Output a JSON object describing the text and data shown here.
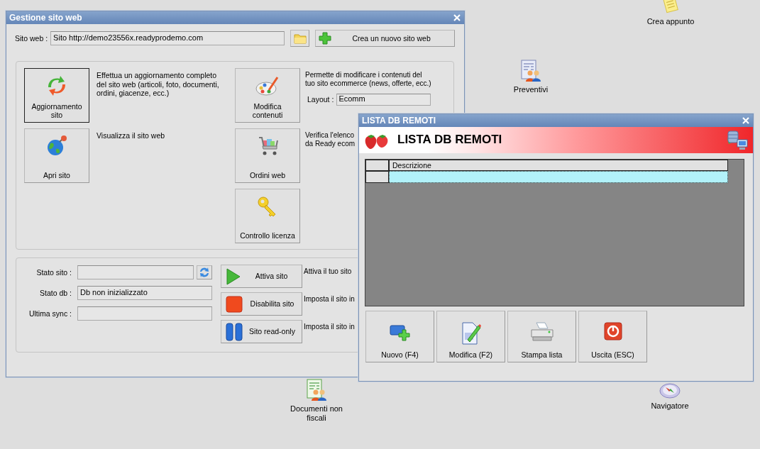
{
  "desktop_icons": [
    {
      "label": "Crea appunto"
    },
    {
      "label": "Preventivi"
    },
    {
      "label": "Documenti non fiscali"
    },
    {
      "label": "Navigatore"
    }
  ],
  "main_window": {
    "title": "Gestione sito web",
    "site": {
      "label": "Sito web :",
      "value": "Sito http://demo23556x.readyprodemo.com"
    },
    "create_button": "Crea un nuovo sito web",
    "tiles": [
      {
        "label": "Aggiornamento\nsito",
        "focused": true,
        "description": "Effettua un aggiornamento completo del sito web (articoli, foto, documenti, ordini, giacenze, ecc.)"
      },
      {
        "label": "Apri sito",
        "focused": false,
        "description": "Visualizza il sito web"
      },
      {
        "label": "Modifica\ncontenuti",
        "focused": false,
        "description": "Permette di modificare i contenuti del tuo sito ecommerce (news, offerte, ecc.)",
        "layout": {
          "label": "Layout :",
          "value": "Ecomm"
        }
      },
      {
        "label": "Ordini web",
        "focused": false,
        "description": "Verifica l'elenco\nda Ready ecom"
      },
      {
        "label": "Controllo licenza",
        "focused": false
      }
    ],
    "status_fields": [
      {
        "label": "Stato sito :"
      },
      {
        "label": "Stato db :",
        "value": "Db non inizializzato"
      },
      {
        "label": "Ultima sync :"
      }
    ],
    "state_buttons": [
      {
        "label": "Attiva sito",
        "description": "Attiva il tuo sito"
      },
      {
        "label": "Disabilita sito",
        "description": "Imposta il sito in"
      },
      {
        "label": "Sito read-only",
        "description": "Imposta il sito in"
      }
    ]
  },
  "list_window": {
    "title": "LISTA DB REMOTI",
    "header": "LISTA DB REMOTI",
    "columns": [
      "Descrizione"
    ],
    "rows": [
      {
        "selected": true
      }
    ],
    "buttons": [
      "Nuovo (F4)",
      "Modifica (F2)",
      "Stampa lista",
      "Uscita (ESC)"
    ]
  }
}
